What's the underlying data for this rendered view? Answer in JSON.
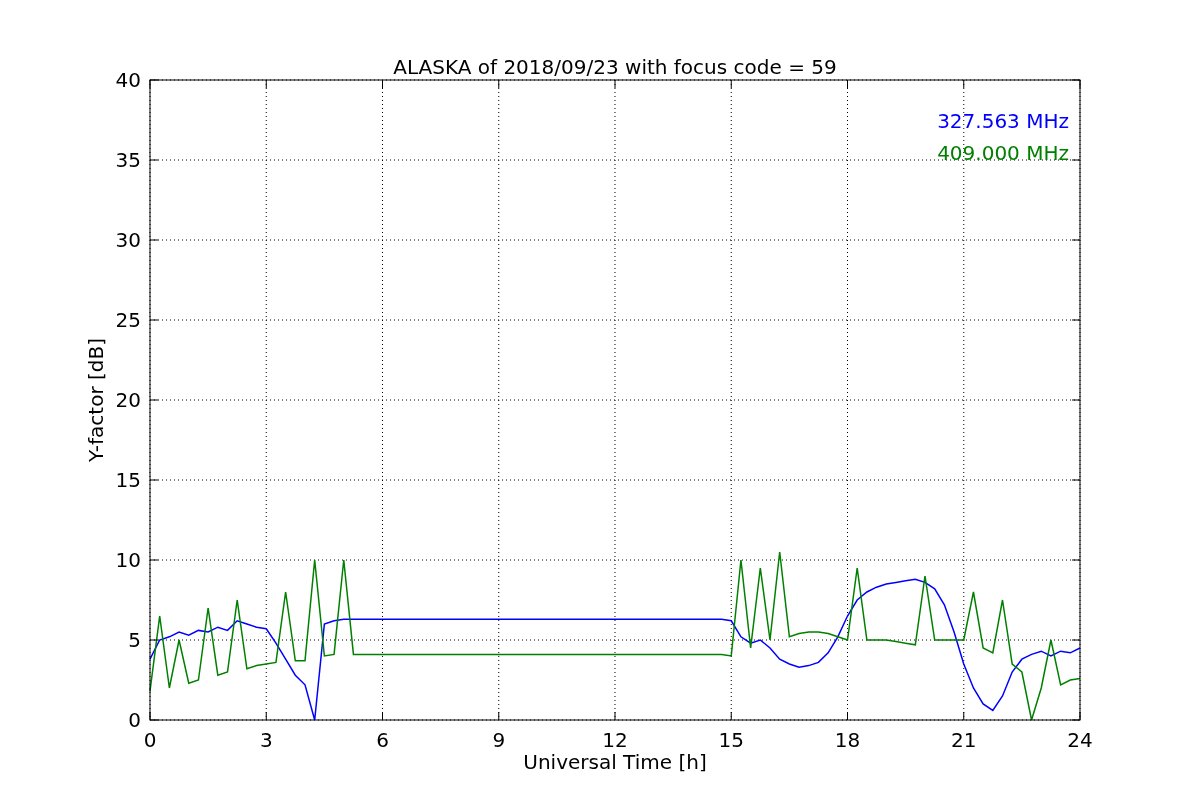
{
  "figure": {
    "chart_data": {
      "type": "line",
      "title": "ALASKA of 2018/09/23 with focus code = 59",
      "xlabel": "Universal Time [h]",
      "ylabel": "Y-factor [dB]",
      "grid": true,
      "xlim": [
        0,
        24
      ],
      "ylim": [
        0,
        40
      ],
      "xticks": [
        0,
        3,
        6,
        9,
        12,
        15,
        18,
        21,
        24
      ],
      "yticks": [
        0,
        5,
        10,
        15,
        20,
        25,
        30,
        35,
        40
      ],
      "x": [
        0,
        0.25,
        0.5,
        0.75,
        1,
        1.25,
        1.5,
        1.75,
        2,
        2.25,
        2.5,
        2.75,
        3,
        3.25,
        3.5,
        3.75,
        4,
        4.25,
        4.5,
        4.75,
        5,
        5.25,
        5.5,
        5.75,
        6,
        6.25,
        6.5,
        6.75,
        7,
        7.25,
        7.5,
        7.75,
        8,
        8.25,
        8.5,
        8.75,
        9,
        9.25,
        9.5,
        9.75,
        10,
        10.25,
        10.5,
        10.75,
        11,
        11.25,
        11.5,
        11.75,
        12,
        12.25,
        12.5,
        12.75,
        13,
        13.25,
        13.5,
        13.75,
        14,
        14.25,
        14.5,
        14.75,
        15,
        15.25,
        15.5,
        15.75,
        16,
        16.25,
        16.5,
        16.75,
        17,
        17.25,
        17.5,
        17.75,
        18,
        18.25,
        18.5,
        18.75,
        19,
        19.25,
        19.5,
        19.75,
        20,
        20.25,
        20.5,
        20.75,
        21,
        21.25,
        21.5,
        21.75,
        22,
        22.25,
        22.5,
        22.75,
        23,
        23.25,
        23.5,
        23.75,
        24
      ],
      "series": [
        {
          "name": "327.563 MHz",
          "color": "#0000ff",
          "values": [
            3.8,
            5,
            5.2,
            5.5,
            5.3,
            5.6,
            5.5,
            5.8,
            5.6,
            6.2,
            6,
            5.8,
            5.7,
            4.8,
            3.8,
            2.8,
            2.2,
            0,
            6,
            6.2,
            6.3,
            6.3,
            6.3,
            6.3,
            6.3,
            6.3,
            6.3,
            6.3,
            6.3,
            6.3,
            6.3,
            6.3,
            6.3,
            6.3,
            6.3,
            6.3,
            6.3,
            6.3,
            6.3,
            6.3,
            6.3,
            6.3,
            6.3,
            6.3,
            6.3,
            6.3,
            6.3,
            6.3,
            6.3,
            6.3,
            6.3,
            6.3,
            6.3,
            6.3,
            6.3,
            6.3,
            6.3,
            6.3,
            6.3,
            6.3,
            6.2,
            5.2,
            4.8,
            5,
            4.5,
            3.8,
            3.5,
            3.3,
            3.4,
            3.6,
            4.2,
            5.2,
            6.5,
            7.5,
            8,
            8.3,
            8.5,
            8.6,
            8.7,
            8.8,
            8.6,
            8.2,
            7.2,
            5.5,
            3.5,
            2,
            1,
            0.6,
            1.5,
            3,
            3.8,
            4.1,
            4.3,
            4,
            4.3,
            4.2,
            4.5
          ]
        },
        {
          "name": "409.000 MHz",
          "color": "#008000",
          "values": [
            1.8,
            6.5,
            2,
            5,
            2.3,
            2.5,
            7,
            2.8,
            3,
            7.5,
            3.2,
            3.4,
            3.5,
            3.6,
            8,
            3.7,
            3.7,
            10,
            4,
            4.1,
            10,
            4.1,
            4.1,
            4.1,
            4.1,
            4.1,
            4.1,
            4.1,
            4.1,
            4.1,
            4.1,
            4.1,
            4.1,
            4.1,
            4.1,
            4.1,
            4.1,
            4.1,
            4.1,
            4.1,
            4.1,
            4.1,
            4.1,
            4.1,
            4.1,
            4.1,
            4.1,
            4.1,
            4.1,
            4.1,
            4.1,
            4.1,
            4.1,
            4.1,
            4.1,
            4.1,
            4.1,
            4.1,
            4.1,
            4.1,
            4,
            10,
            4.5,
            9.5,
            5,
            10.5,
            5.2,
            5.4,
            5.5,
            5.5,
            5.4,
            5.2,
            5,
            9.5,
            5,
            5,
            5,
            4.9,
            4.8,
            4.7,
            9,
            5,
            5,
            5,
            5,
            8,
            4.5,
            4.2,
            7.5,
            3.5,
            3,
            0,
            2,
            5,
            2.2,
            2.5,
            2.6
          ]
        }
      ]
    }
  }
}
